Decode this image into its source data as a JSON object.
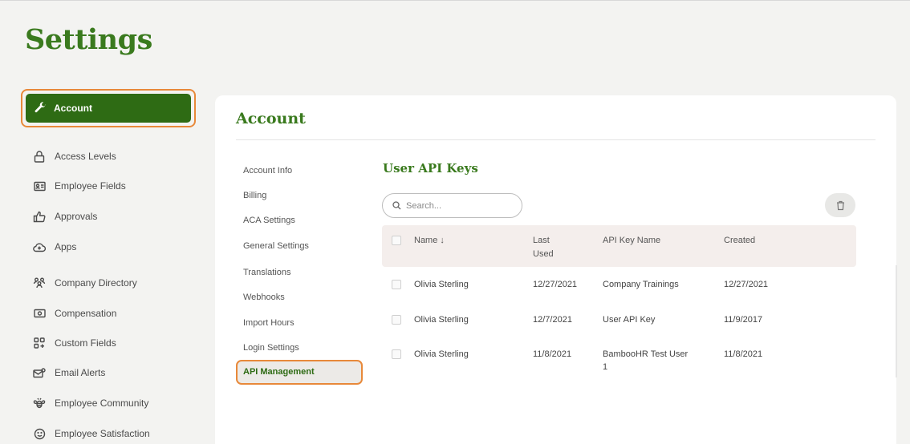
{
  "page": {
    "title": "Settings"
  },
  "sidebar": {
    "active_label": "Account",
    "items": [
      {
        "label": "Access Levels",
        "icon": "lock-icon"
      },
      {
        "label": "Employee Fields",
        "icon": "id-card-icon"
      },
      {
        "label": "Approvals",
        "icon": "thumbs-up-icon"
      },
      {
        "label": "Apps",
        "icon": "cloud-plus-icon"
      },
      {
        "label": "Company Directory",
        "icon": "people-icon"
      },
      {
        "label": "Compensation",
        "icon": "money-icon"
      },
      {
        "label": "Custom Fields",
        "icon": "grid-plus-icon"
      },
      {
        "label": "Email Alerts",
        "icon": "mail-icon"
      },
      {
        "label": "Employee Community",
        "icon": "bee-icon"
      },
      {
        "label": "Employee Satisfaction",
        "icon": "smiley-icon"
      }
    ]
  },
  "main": {
    "title": "Account",
    "subnav": [
      "Account Info",
      "Billing",
      "ACA Settings",
      "General Settings",
      "Translations",
      "Webhooks",
      "Import Hours",
      "Login Settings"
    ],
    "subnav_active": "API Management",
    "section_title": "User API Keys",
    "search_placeholder": "Search...",
    "table": {
      "headers": {
        "name": "Name ↓",
        "last_used_1": "Last",
        "last_used_2": "Used",
        "api_key_name": "API Key Name",
        "created": "Created"
      },
      "rows": [
        {
          "name": "Olivia Sterling",
          "last_used": "12/27/2021",
          "key_name_1": "Company Trainings",
          "key_name_2": "",
          "created": "12/27/2021"
        },
        {
          "name": "Olivia Sterling",
          "last_used": "12/7/2021",
          "key_name_1": "User API Key",
          "key_name_2": "",
          "created": "11/9/2017"
        },
        {
          "name": "Olivia Sterling",
          "last_used": "11/8/2021",
          "key_name_1": "BambooHR Test User",
          "key_name_2": "1",
          "created": "11/8/2021"
        }
      ]
    }
  },
  "colors": {
    "brand_green": "#2e6b14",
    "title_green": "#3a7a1e",
    "highlight_orange": "#e8893a"
  }
}
